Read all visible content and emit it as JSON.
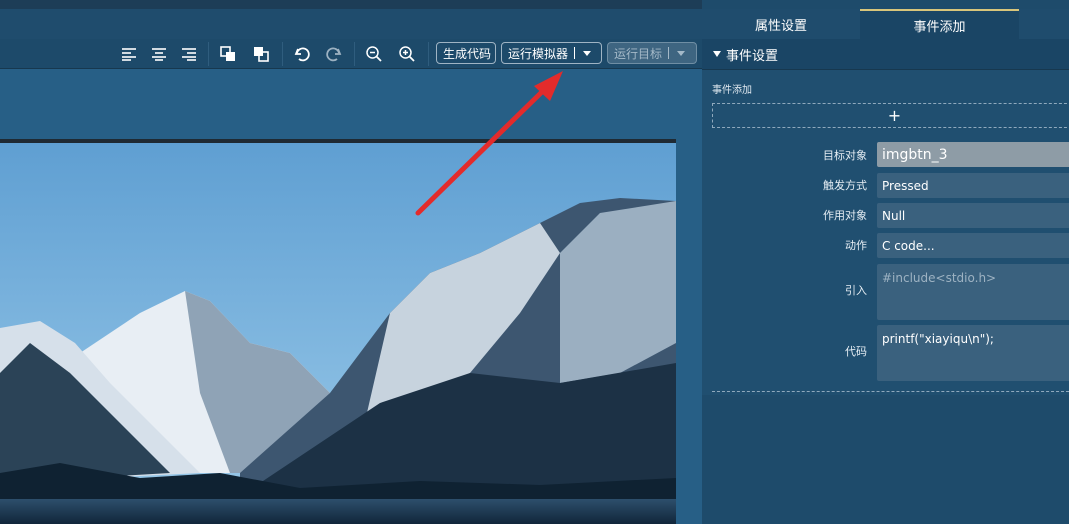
{
  "toolbar": {
    "icons": [
      "align-left-icon",
      "align-center-icon",
      "align-right-icon",
      "bring-forward-icon",
      "send-backward-icon",
      "undo-icon",
      "redo-icon",
      "zoom-out-icon",
      "zoom-in-icon"
    ],
    "generate_code": "生成代码",
    "run_simulator": "运行模拟器",
    "run_target": "运行目标"
  },
  "right_panel": {
    "tabs": [
      "属性设置",
      "事件添加"
    ],
    "active_tab": 1,
    "section_title": "事件设置",
    "event_add_label": "事件添加",
    "add_symbol": "+",
    "fields": [
      {
        "label": "目标对象",
        "value": "imgbtn_3"
      },
      {
        "label": "触发方式",
        "value": "Pressed"
      },
      {
        "label": "作用对象",
        "value": "Null"
      },
      {
        "label": "动作",
        "value": "C code..."
      },
      {
        "label": "引入",
        "placeholder": "#include<stdio.h>"
      },
      {
        "label": "代码",
        "value": "printf(\"xiayiqu\\n\");"
      }
    ]
  },
  "colors": {
    "annotation_arrow": "#e32b2b",
    "active_tab_underline": "#d8c57b"
  }
}
